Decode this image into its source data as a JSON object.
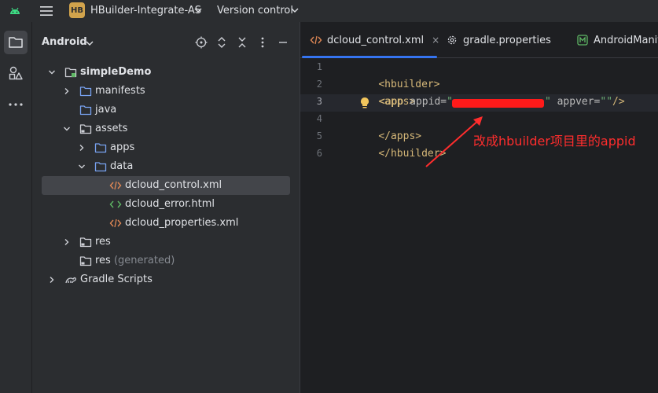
{
  "titlebar": {
    "project_badge": "HB",
    "project_name": "HBuilder-Integrate-AS",
    "vcs_label": "Version control"
  },
  "project_panel": {
    "title": "Android",
    "tree": [
      {
        "label": "simpleDemo",
        "level": 0,
        "bold": true,
        "icon": "module-folder-icon",
        "expanded": true
      },
      {
        "label": "manifests",
        "level": 1,
        "icon": "folder-icon",
        "expanded": false
      },
      {
        "label": "java",
        "level": 1,
        "icon": "folder-icon",
        "expanded": null
      },
      {
        "label": "assets",
        "level": 1,
        "icon": "resource-folder-icon",
        "expanded": true
      },
      {
        "label": "apps",
        "level": 2,
        "icon": "folder-icon",
        "expanded": false
      },
      {
        "label": "data",
        "level": 2,
        "icon": "folder-icon",
        "expanded": true
      },
      {
        "label": "dcloud_control.xml",
        "level": 3,
        "icon": "xml-file-icon",
        "selected": true
      },
      {
        "label": "dcloud_error.html",
        "level": 3,
        "icon": "html-file-icon"
      },
      {
        "label": "dcloud_properties.xml",
        "level": 3,
        "icon": "xml-file-icon"
      },
      {
        "label": "res",
        "level": 1,
        "icon": "resource-folder-icon",
        "expanded": false
      },
      {
        "label": "res",
        "sub": "(generated)",
        "level": 1,
        "icon": "resource-folder-icon",
        "expanded": null
      },
      {
        "label": "Gradle Scripts",
        "level": 0,
        "icon": "gradle-icon",
        "expanded": false
      }
    ]
  },
  "editor": {
    "tabs": [
      {
        "label": "dcloud_control.xml",
        "icon": "xml-file-icon",
        "active": true,
        "close": "×"
      },
      {
        "label": "gradle.properties",
        "icon": "gear-icon",
        "active": false
      },
      {
        "label": "AndroidManife",
        "icon": "manifest-icon",
        "active": false
      }
    ],
    "line_numbers": [
      "1",
      "2",
      "3",
      "4",
      "5",
      "6"
    ],
    "code": {
      "l1_tag": "<hbuilder>",
      "l2_tag": "<apps>",
      "l3_open": "<app ",
      "l3_attr1": "appid=",
      "l3_val1_open": "\"",
      "l3_val1_close": "\"",
      "l3_attr2": " appver=",
      "l3_val2": "\"\"",
      "l3_close": "/>",
      "l4_tag": "</apps>",
      "l5_tag": "</hbuilder>"
    },
    "annotation": "改成hbuilder项目里的appid"
  },
  "colors": {
    "accent": "#3574f0",
    "annotation": "#ff2d2d",
    "xml_tag": "#d5b778",
    "xml_string": "#6aab73"
  }
}
